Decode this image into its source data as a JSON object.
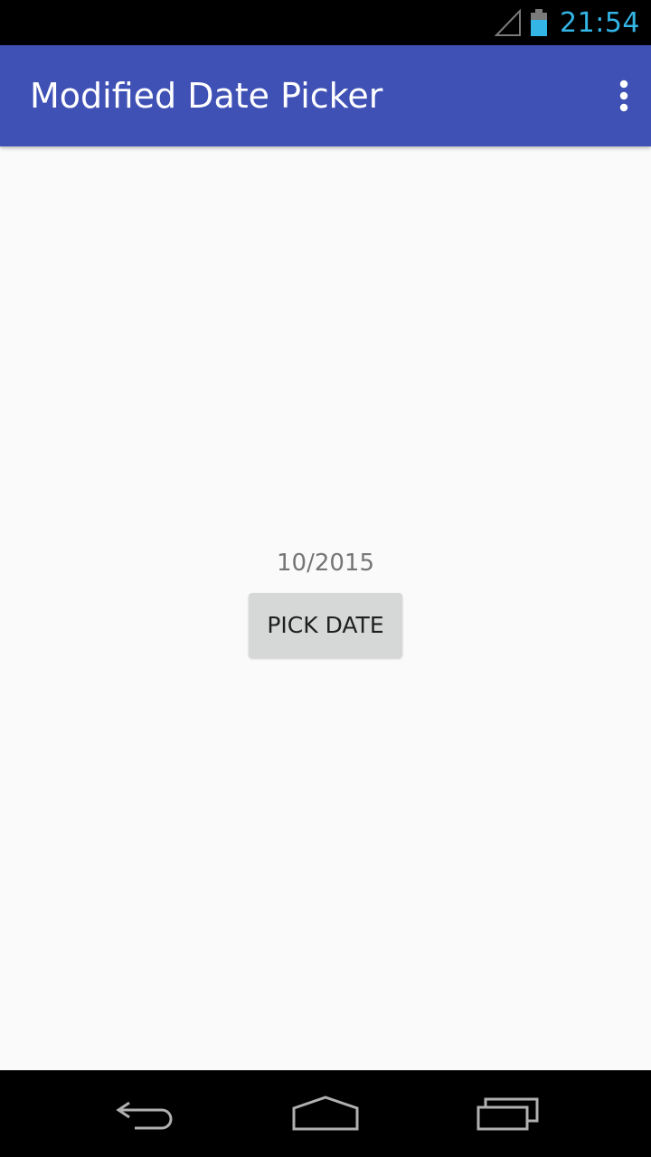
{
  "status_bar": {
    "time": "21:54",
    "signal_icon": "signal-icon",
    "battery_icon": "battery-icon",
    "accent_color": "#33b5e5"
  },
  "app_bar": {
    "title": "Modified Date Picker",
    "overflow_icon": "overflow-menu-icon",
    "color": "#3f51b5"
  },
  "main": {
    "date_value": "10/2015",
    "pick_button_label": "PICK DATE"
  },
  "nav_bar": {
    "back_icon": "back-icon",
    "home_icon": "home-icon",
    "recents_icon": "recents-icon"
  }
}
